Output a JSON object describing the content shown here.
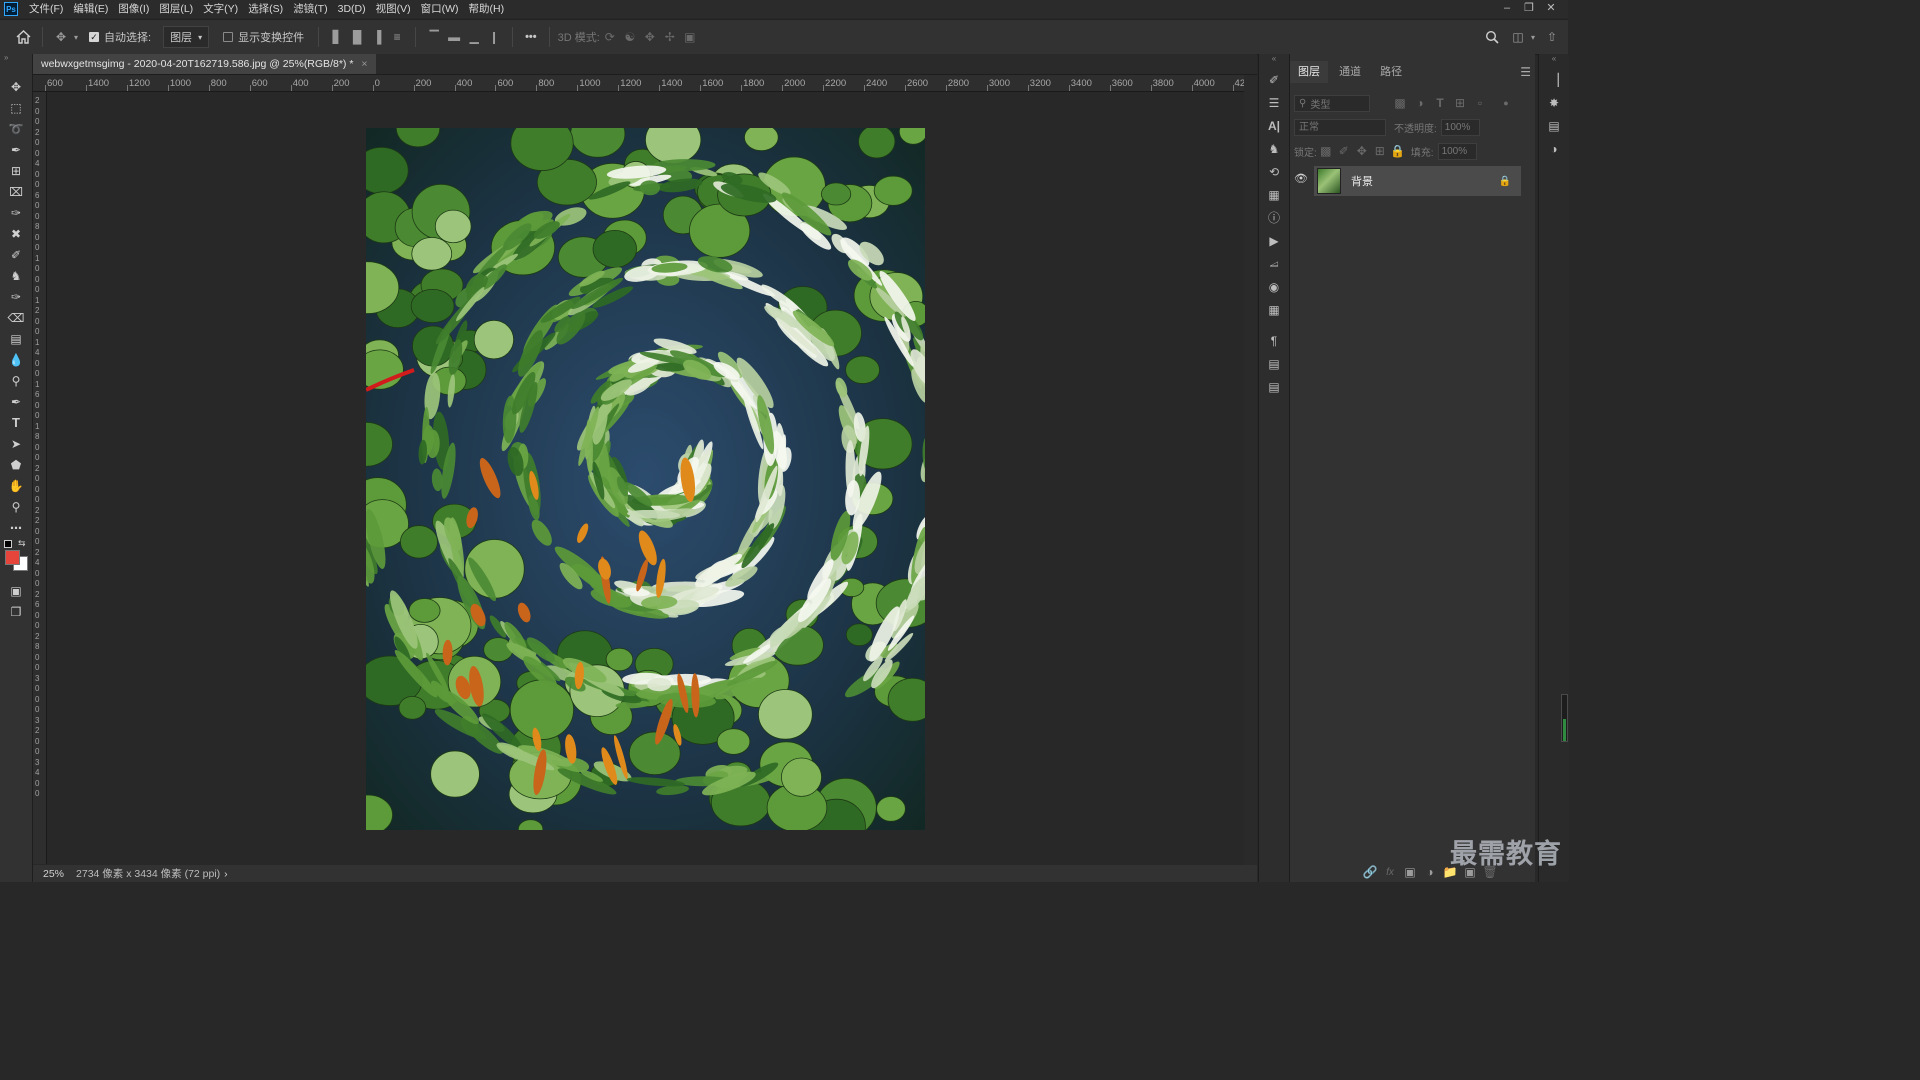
{
  "menu": {
    "items": [
      "文件(F)",
      "编辑(E)",
      "图像(I)",
      "图层(L)",
      "文字(Y)",
      "选择(S)",
      "滤镜(T)",
      "3D(D)",
      "视图(V)",
      "窗口(W)",
      "帮助(H)"
    ],
    "logo": "Ps"
  },
  "options": {
    "auto_select_label": "自动选择:",
    "auto_select_checked": true,
    "auto_select_target": "图层",
    "show_transform_label": "显示变换控件",
    "show_transform_checked": false,
    "more": "•••",
    "mode_3d_label": "3D 模式:"
  },
  "document": {
    "tab_title": "webwxgetmsgimg - 2020-04-20T162719.586.jpg @ 25%(RGB/8*) *",
    "tab_close": "×",
    "zoom": "25%",
    "doc_info": "2734 像素 x 3434 像素 (72 ppi)",
    "doc_info_arrow": "›"
  },
  "ruler": {
    "h_labels": [
      "600",
      "1400",
      "1200",
      "1000",
      "800",
      "600",
      "400",
      "200",
      "0",
      "200",
      "400",
      "600",
      "800",
      "1000",
      "1200",
      "1400",
      "1600",
      "1800",
      "2000",
      "2200",
      "2400",
      "2600",
      "2800",
      "3000",
      "3200",
      "3400",
      "3600",
      "3800",
      "4000",
      "420"
    ],
    "v_labels": [
      "2",
      "0",
      "0",
      "2",
      "0",
      "0",
      "4",
      "0",
      "0",
      "6",
      "0",
      "0",
      "8",
      "0",
      "0",
      "1",
      "0",
      "0",
      "0",
      "1",
      "2",
      "0",
      "0",
      "1",
      "4",
      "0",
      "0",
      "1",
      "6",
      "0",
      "0",
      "1",
      "8",
      "0",
      "0",
      "2",
      "0",
      "0",
      "0",
      "2",
      "2",
      "0",
      "0",
      "2",
      "4",
      "0",
      "0",
      "2",
      "6",
      "0",
      "0",
      "2",
      "8",
      "0",
      "0",
      "3",
      "0",
      "0",
      "0",
      "3",
      "2",
      "0",
      "0",
      "3",
      "4",
      "0",
      "0"
    ]
  },
  "layers_panel": {
    "tabs": [
      "图层",
      "通道",
      "路径"
    ],
    "filter_label": "类型",
    "blend_mode": "正常",
    "opacity_label": "不透明度:",
    "opacity_value": "100%",
    "lock_label": "锁定:",
    "fill_label": "填充:",
    "fill_value": "100%",
    "layers": [
      {
        "name": "背景",
        "visible": true,
        "locked": true
      }
    ]
  },
  "colors": {
    "foreground": "#e5453a",
    "background": "#ffffff"
  },
  "watermark": "最需教育"
}
